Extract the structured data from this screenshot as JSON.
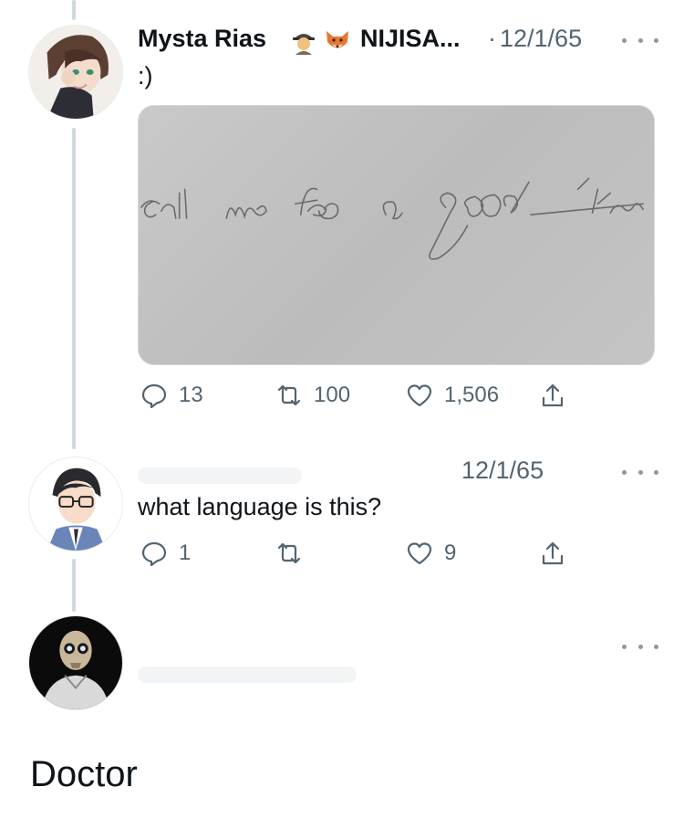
{
  "tweet1": {
    "display_name": "Mysta Rias",
    "handle": "NIJISA...",
    "separator": "·",
    "time": "12/1/65",
    "text": ":)",
    "badges": [
      "detective-emoji",
      "fox-emoji"
    ],
    "image": {
      "handwriting": "call me for a good time"
    },
    "stats": {
      "replies": "13",
      "retweets": "100",
      "likes": "1,506"
    }
  },
  "tweet2": {
    "time": "12/1/65",
    "text": "what language is this?",
    "stats": {
      "replies": "1",
      "retweets": "",
      "likes": "9"
    }
  },
  "tweet3": {
    "text": ""
  },
  "caption": "Doctor"
}
